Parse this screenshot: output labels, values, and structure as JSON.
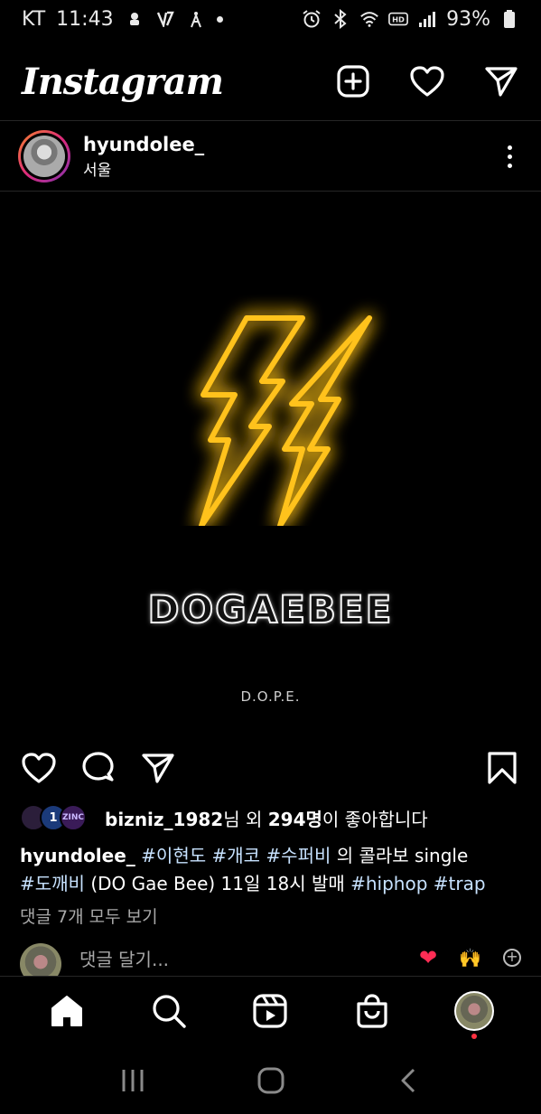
{
  "status_bar": {
    "carrier": "KT",
    "time": "11:43",
    "battery": "93%"
  },
  "header": {
    "logo": "Instagram",
    "icons": [
      "new-post-icon",
      "heart-icon",
      "direct-message-icon"
    ]
  },
  "post": {
    "username": "hyundolee_",
    "location": "서울",
    "image": {
      "brand": "DOGAEBEE",
      "subtitle": "D.O.P.E."
    },
    "likes": {
      "first_liker": "bizniz_1982",
      "suffix_a": "님 외 ",
      "count": "294명",
      "suffix_b": "이 좋아합니다",
      "avatar_labels": [
        "",
        "1",
        "ZINC"
      ]
    },
    "caption": {
      "author": "hyundolee_",
      "tag1": "#이현도",
      "tag2": "#개코",
      "tag3": "#수퍼비",
      "text1": "의 콜라보 single",
      "tag4": "#도깨비",
      "text2": "(DO Gae Bee) 11일 18시 발매",
      "tag5": "#hiphop",
      "tag6": "#trap"
    },
    "view_comments": "댓글 7개 모두 보기",
    "comment_placeholder": "댓글 달기...",
    "quick_emojis": [
      "❤",
      "🙌",
      "+"
    ]
  },
  "bottom_nav": [
    "home-icon",
    "search-icon",
    "reels-icon",
    "shop-icon",
    "profile-avatar"
  ],
  "colors": {
    "background": "#000000",
    "bolt": "#ffb800",
    "hashtag": "#c7e2ff",
    "secondary_text": "#a8a8a8",
    "notification_dot": "#ff3040"
  }
}
